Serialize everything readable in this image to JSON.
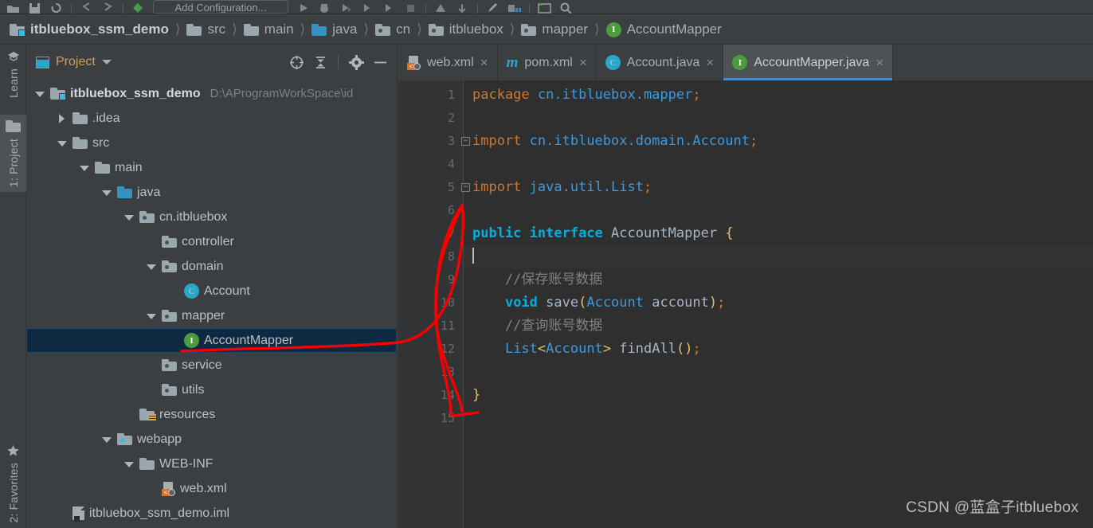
{
  "toolbar": {
    "run_config_label": "Add Configuration...",
    "icons": [
      "open-folder-icon",
      "save-all-icon",
      "sync-icon",
      "undo-icon",
      "redo-icon",
      "vcs-icon",
      "run-icon",
      "debug-icon",
      "run-coverage-icon",
      "profile-icon",
      "rerun-icon",
      "stop-icon",
      "build-icon",
      "project-structure-icon",
      "update-project-icon",
      "edit-icon",
      "app-grid-icon",
      "window-icon",
      "search-icon"
    ]
  },
  "breadcrumb": [
    {
      "label": "itbluebox_ssm_demo",
      "icon": "module-folder-icon"
    },
    {
      "label": "src",
      "icon": "folder-icon"
    },
    {
      "label": "main",
      "icon": "folder-icon"
    },
    {
      "label": "java",
      "icon": "source-folder-icon"
    },
    {
      "label": "cn",
      "icon": "package-icon"
    },
    {
      "label": "itbluebox",
      "icon": "package-icon"
    },
    {
      "label": "mapper",
      "icon": "package-icon"
    },
    {
      "label": "AccountMapper",
      "icon": "interface-icon"
    }
  ],
  "rail": {
    "learn": {
      "label": "Learn",
      "icon": "learn-icon"
    },
    "project": {
      "label": "1: Project",
      "icon": "project-folder-icon"
    },
    "favorites": {
      "label": "2: Favorites",
      "icon": "star-icon"
    }
  },
  "panel": {
    "title": "Project",
    "actions": [
      "locate-icon",
      "collapse-all-icon",
      "settings-gear-icon",
      "hide-icon"
    ],
    "tree": [
      {
        "label": "itbluebox_ssm_demo",
        "path": "D:\\AProgramWorkSpace\\id",
        "depth": 0,
        "twisty": "open",
        "icon": "module-folder-icon",
        "selected": false
      },
      {
        "label": ".idea",
        "depth": 1,
        "twisty": "closed",
        "icon": "folder-icon",
        "selected": false
      },
      {
        "label": "src",
        "depth": 1,
        "twisty": "open",
        "icon": "folder-icon",
        "selected": false
      },
      {
        "label": "main",
        "depth": 2,
        "twisty": "open",
        "icon": "folder-icon",
        "selected": false
      },
      {
        "label": "java",
        "depth": 3,
        "twisty": "open",
        "icon": "source-folder-icon",
        "selected": false
      },
      {
        "label": "cn.itbluebox",
        "depth": 4,
        "twisty": "open",
        "icon": "package-icon",
        "selected": false
      },
      {
        "label": "controller",
        "depth": 5,
        "twisty": "none",
        "icon": "package-icon",
        "selected": false
      },
      {
        "label": "domain",
        "depth": 5,
        "twisty": "open",
        "icon": "package-icon",
        "selected": false
      },
      {
        "label": "Account",
        "depth": 6,
        "twisty": "none",
        "icon": "class-icon",
        "selected": false
      },
      {
        "label": "mapper",
        "depth": 5,
        "twisty": "open",
        "icon": "package-icon",
        "selected": false
      },
      {
        "label": "AccountMapper",
        "depth": 6,
        "twisty": "none",
        "icon": "interface-icon",
        "selected": true
      },
      {
        "label": "service",
        "depth": 5,
        "twisty": "none",
        "icon": "package-icon",
        "selected": false
      },
      {
        "label": "utils",
        "depth": 5,
        "twisty": "none",
        "icon": "package-icon",
        "selected": false
      },
      {
        "label": "resources",
        "depth": 4,
        "twisty": "none",
        "icon": "resources-folder-icon",
        "selected": false
      },
      {
        "label": "webapp",
        "depth": 3,
        "twisty": "open",
        "icon": "webapp-folder-icon",
        "selected": false
      },
      {
        "label": "WEB-INF",
        "depth": 4,
        "twisty": "open",
        "icon": "folder-icon",
        "selected": false
      },
      {
        "label": "web.xml",
        "depth": 5,
        "twisty": "none",
        "icon": "xml-file-icon",
        "selected": false
      },
      {
        "label": "itbluebox_ssm_demo.iml",
        "depth": 1,
        "twisty": "none",
        "icon": "iml-file-icon",
        "selected": false
      }
    ]
  },
  "editor": {
    "tabs": [
      {
        "label": "web.xml",
        "icon": "xml-file-icon",
        "active": false,
        "closable": true
      },
      {
        "label": "pom.xml",
        "icon": "maven-icon",
        "active": false,
        "closable": true
      },
      {
        "label": "Account.java",
        "icon": "class-icon",
        "active": false,
        "closable": true
      },
      {
        "label": "AccountMapper.java",
        "icon": "interface-icon",
        "active": true,
        "closable": true
      }
    ],
    "close_glyph": "×",
    "line_numbers": [
      "1",
      "2",
      "3",
      "4",
      "5",
      "6",
      "7",
      "8",
      "9",
      "10",
      "11",
      "12",
      "13",
      "14",
      "15"
    ],
    "caret_line": 8,
    "code_lines": [
      {
        "n": 1,
        "tokens": [
          {
            "t": "package ",
            "c": "kw"
          },
          {
            "t": "cn.itbluebox.mapper",
            "c": "pkgname"
          },
          {
            "t": ";",
            "c": "punc"
          }
        ]
      },
      {
        "n": 2,
        "tokens": []
      },
      {
        "n": 3,
        "fold": "minus",
        "tokens": [
          {
            "t": "import ",
            "c": "kw"
          },
          {
            "t": "cn.itbluebox.domain.Account",
            "c": "pkgname"
          },
          {
            "t": ";",
            "c": "punc"
          }
        ]
      },
      {
        "n": 4,
        "tokens": []
      },
      {
        "n": 5,
        "fold": "minus-end",
        "tokens": [
          {
            "t": "import ",
            "c": "kw"
          },
          {
            "t": "java.util.List",
            "c": "pkgname"
          },
          {
            "t": ";",
            "c": "punc"
          }
        ]
      },
      {
        "n": 6,
        "tokens": []
      },
      {
        "n": 7,
        "tokens": [
          {
            "t": "public ",
            "c": "kw2"
          },
          {
            "t": "interface ",
            "c": "kw2"
          },
          {
            "t": "AccountMapper ",
            "c": "plain"
          },
          {
            "t": "{",
            "c": "brace"
          }
        ]
      },
      {
        "n": 8,
        "tokens": [
          {
            "t": "",
            "c": "caret"
          }
        ]
      },
      {
        "n": 9,
        "tokens": [
          {
            "t": "    //保存账号数据",
            "c": "cmt"
          }
        ]
      },
      {
        "n": 10,
        "tokens": [
          {
            "t": "    ",
            "c": "plain"
          },
          {
            "t": "void",
            "c": "kw2"
          },
          {
            "t": " save",
            "c": "plain"
          },
          {
            "t": "(",
            "c": "brace"
          },
          {
            "t": "Account",
            "c": "str"
          },
          {
            "t": " account",
            "c": "typ"
          },
          {
            "t": ")",
            "c": "brace"
          },
          {
            "t": ";",
            "c": "punc"
          }
        ]
      },
      {
        "n": 11,
        "tokens": [
          {
            "t": "    //查询账号数据",
            "c": "cmt"
          }
        ]
      },
      {
        "n": 12,
        "tokens": [
          {
            "t": "    ",
            "c": "plain"
          },
          {
            "t": "List",
            "c": "str"
          },
          {
            "t": "<",
            "c": "brace"
          },
          {
            "t": "Account",
            "c": "str"
          },
          {
            "t": ">",
            "c": "brace"
          },
          {
            "t": " findAll",
            "c": "plain"
          },
          {
            "t": "(",
            "c": "brace"
          },
          {
            "t": ")",
            "c": "brace"
          },
          {
            "t": ";",
            "c": "punc"
          }
        ]
      },
      {
        "n": 13,
        "tokens": []
      },
      {
        "n": 14,
        "tokens": [
          {
            "t": "}",
            "c": "brace"
          }
        ]
      },
      {
        "n": 15,
        "tokens": []
      }
    ]
  },
  "annotation": {
    "color": "#f80000",
    "name": "red-handdrawn-arrow"
  },
  "watermark": "CSDN @蓝盒子itbluebox",
  "colors": {
    "panel_bg": "#3c3f41",
    "editor_bg": "#2f2f2f",
    "gutter_bg": "#313335",
    "selection_bg": "#0d2a42",
    "tab_active_underline": "#4a88c7",
    "accent_orange": "#c8a05a"
  }
}
